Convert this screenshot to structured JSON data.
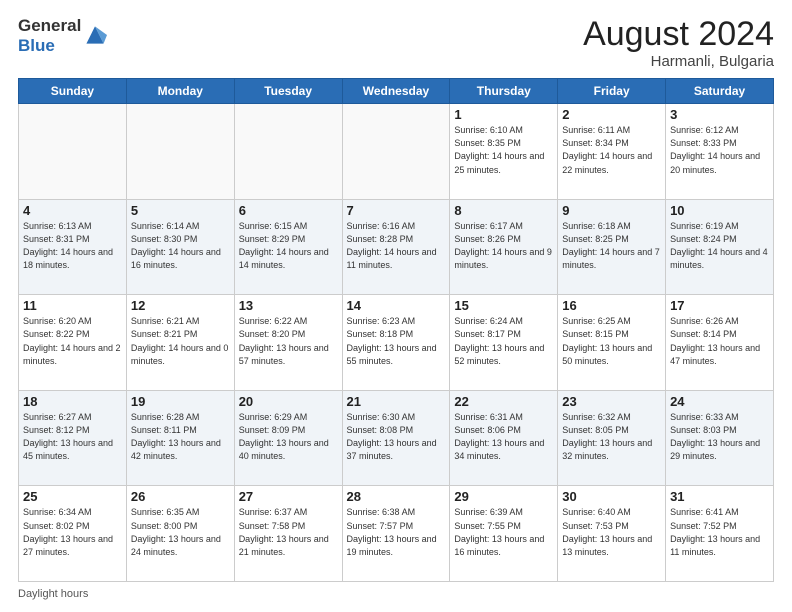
{
  "header": {
    "logo_general": "General",
    "logo_blue": "Blue",
    "month_year": "August 2024",
    "location": "Harmanli, Bulgaria"
  },
  "footer": {
    "label": "Daylight hours"
  },
  "days_of_week": [
    "Sunday",
    "Monday",
    "Tuesday",
    "Wednesday",
    "Thursday",
    "Friday",
    "Saturday"
  ],
  "weeks": [
    [
      {
        "day": "",
        "info": ""
      },
      {
        "day": "",
        "info": ""
      },
      {
        "day": "",
        "info": ""
      },
      {
        "day": "",
        "info": ""
      },
      {
        "day": "1",
        "info": "Sunrise: 6:10 AM\nSunset: 8:35 PM\nDaylight: 14 hours and 25 minutes."
      },
      {
        "day": "2",
        "info": "Sunrise: 6:11 AM\nSunset: 8:34 PM\nDaylight: 14 hours and 22 minutes."
      },
      {
        "day": "3",
        "info": "Sunrise: 6:12 AM\nSunset: 8:33 PM\nDaylight: 14 hours and 20 minutes."
      }
    ],
    [
      {
        "day": "4",
        "info": "Sunrise: 6:13 AM\nSunset: 8:31 PM\nDaylight: 14 hours and 18 minutes."
      },
      {
        "day": "5",
        "info": "Sunrise: 6:14 AM\nSunset: 8:30 PM\nDaylight: 14 hours and 16 minutes."
      },
      {
        "day": "6",
        "info": "Sunrise: 6:15 AM\nSunset: 8:29 PM\nDaylight: 14 hours and 14 minutes."
      },
      {
        "day": "7",
        "info": "Sunrise: 6:16 AM\nSunset: 8:28 PM\nDaylight: 14 hours and 11 minutes."
      },
      {
        "day": "8",
        "info": "Sunrise: 6:17 AM\nSunset: 8:26 PM\nDaylight: 14 hours and 9 minutes."
      },
      {
        "day": "9",
        "info": "Sunrise: 6:18 AM\nSunset: 8:25 PM\nDaylight: 14 hours and 7 minutes."
      },
      {
        "day": "10",
        "info": "Sunrise: 6:19 AM\nSunset: 8:24 PM\nDaylight: 14 hours and 4 minutes."
      }
    ],
    [
      {
        "day": "11",
        "info": "Sunrise: 6:20 AM\nSunset: 8:22 PM\nDaylight: 14 hours and 2 minutes."
      },
      {
        "day": "12",
        "info": "Sunrise: 6:21 AM\nSunset: 8:21 PM\nDaylight: 14 hours and 0 minutes."
      },
      {
        "day": "13",
        "info": "Sunrise: 6:22 AM\nSunset: 8:20 PM\nDaylight: 13 hours and 57 minutes."
      },
      {
        "day": "14",
        "info": "Sunrise: 6:23 AM\nSunset: 8:18 PM\nDaylight: 13 hours and 55 minutes."
      },
      {
        "day": "15",
        "info": "Sunrise: 6:24 AM\nSunset: 8:17 PM\nDaylight: 13 hours and 52 minutes."
      },
      {
        "day": "16",
        "info": "Sunrise: 6:25 AM\nSunset: 8:15 PM\nDaylight: 13 hours and 50 minutes."
      },
      {
        "day": "17",
        "info": "Sunrise: 6:26 AM\nSunset: 8:14 PM\nDaylight: 13 hours and 47 minutes."
      }
    ],
    [
      {
        "day": "18",
        "info": "Sunrise: 6:27 AM\nSunset: 8:12 PM\nDaylight: 13 hours and 45 minutes."
      },
      {
        "day": "19",
        "info": "Sunrise: 6:28 AM\nSunset: 8:11 PM\nDaylight: 13 hours and 42 minutes."
      },
      {
        "day": "20",
        "info": "Sunrise: 6:29 AM\nSunset: 8:09 PM\nDaylight: 13 hours and 40 minutes."
      },
      {
        "day": "21",
        "info": "Sunrise: 6:30 AM\nSunset: 8:08 PM\nDaylight: 13 hours and 37 minutes."
      },
      {
        "day": "22",
        "info": "Sunrise: 6:31 AM\nSunset: 8:06 PM\nDaylight: 13 hours and 34 minutes."
      },
      {
        "day": "23",
        "info": "Sunrise: 6:32 AM\nSunset: 8:05 PM\nDaylight: 13 hours and 32 minutes."
      },
      {
        "day": "24",
        "info": "Sunrise: 6:33 AM\nSunset: 8:03 PM\nDaylight: 13 hours and 29 minutes."
      }
    ],
    [
      {
        "day": "25",
        "info": "Sunrise: 6:34 AM\nSunset: 8:02 PM\nDaylight: 13 hours and 27 minutes."
      },
      {
        "day": "26",
        "info": "Sunrise: 6:35 AM\nSunset: 8:00 PM\nDaylight: 13 hours and 24 minutes."
      },
      {
        "day": "27",
        "info": "Sunrise: 6:37 AM\nSunset: 7:58 PM\nDaylight: 13 hours and 21 minutes."
      },
      {
        "day": "28",
        "info": "Sunrise: 6:38 AM\nSunset: 7:57 PM\nDaylight: 13 hours and 19 minutes."
      },
      {
        "day": "29",
        "info": "Sunrise: 6:39 AM\nSunset: 7:55 PM\nDaylight: 13 hours and 16 minutes."
      },
      {
        "day": "30",
        "info": "Sunrise: 6:40 AM\nSunset: 7:53 PM\nDaylight: 13 hours and 13 minutes."
      },
      {
        "day": "31",
        "info": "Sunrise: 6:41 AM\nSunset: 7:52 PM\nDaylight: 13 hours and 11 minutes."
      }
    ]
  ]
}
